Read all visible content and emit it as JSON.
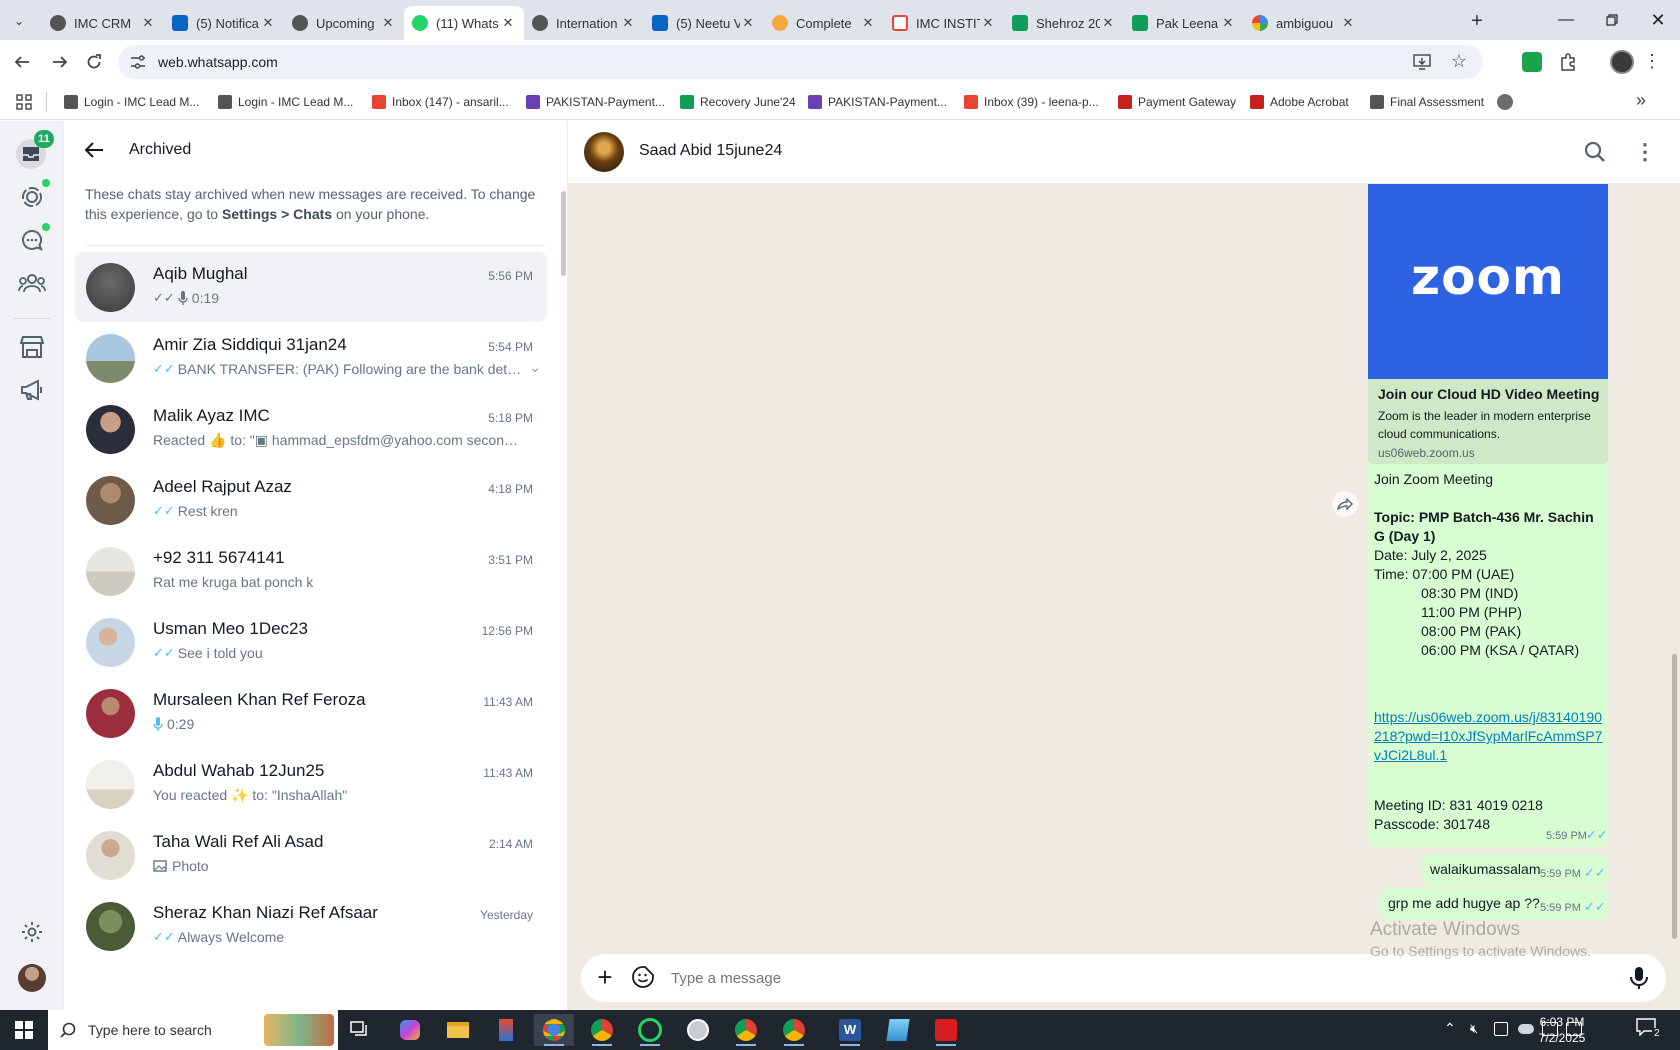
{
  "browser": {
    "tabs": [
      {
        "title": "IMC CRM",
        "icon": "imc-icon"
      },
      {
        "title": "(5) Notifica",
        "icon": "linkedin-icon"
      },
      {
        "title": "Upcoming",
        "icon": "imc-icon"
      },
      {
        "title": "(11) Whats",
        "icon": "whatsapp-icon",
        "active": true
      },
      {
        "title": "Internation",
        "icon": "imc-icon"
      },
      {
        "title": "(5) Neetu V",
        "icon": "linkedin-icon"
      },
      {
        "title": "Complete",
        "icon": "smile-icon"
      },
      {
        "title": "IMC INSTIT",
        "icon": "gmail-icon"
      },
      {
        "title": "Shehroz 20",
        "icon": "sheets-icon"
      },
      {
        "title": "Pak Leena",
        "icon": "sheets-icon"
      },
      {
        "title": "ambiguou",
        "icon": "google-icon"
      }
    ],
    "url": "web.whatsapp.com",
    "bookmarks": [
      {
        "label": "Login - IMC Lead M..."
      },
      {
        "label": "Login - IMC Lead M..."
      },
      {
        "label": "Inbox (147) - ansaril..."
      },
      {
        "label": "PAKISTAN-Payment..."
      },
      {
        "label": "Recovery June'24"
      },
      {
        "label": "PAKISTAN-Payment..."
      },
      {
        "label": "Inbox (39) - leena-p..."
      },
      {
        "label": "Payment Gateway"
      },
      {
        "label": "Adobe Acrobat"
      },
      {
        "label": "Final Assessment"
      }
    ]
  },
  "rail": {
    "unread_badge": "11"
  },
  "archived": {
    "title": "Archived",
    "note_prefix": "These chats stay archived when new messages are received. To change this experience, go to ",
    "note_settings": "Settings > Chats",
    "note_suffix": " on your phone.",
    "chats": [
      {
        "name": "Aqib Mughal",
        "time": "5:56 PM",
        "preview": "0:19",
        "ticks": true,
        "mic": true
      },
      {
        "name": "Amir Zia Siddiqui 31jan24",
        "time": "5:54 PM",
        "preview": "BANK TRANSFER: (PAK) Following are the bank detail...",
        "ticks": true
      },
      {
        "name": "Malik Ayaz IMC",
        "time": "5:18 PM",
        "preview": "Reacted 👍 to: \"▣ hammad_epsfdm@yahoo.com second ..."
      },
      {
        "name": "Adeel Rajput Azaz",
        "time": "4:18 PM",
        "preview": "Rest kren",
        "ticks": true
      },
      {
        "name": "+92 311 5674141",
        "time": "3:51 PM",
        "preview": "Rat me kruga bat ponch k"
      },
      {
        "name": "Usman Meo 1Dec23",
        "time": "12:56 PM",
        "preview": "See i told you",
        "ticks": true
      },
      {
        "name": "Mursaleen Khan Ref Feroza",
        "time": "11:43 AM",
        "preview": "0:29",
        "mic": true
      },
      {
        "name": "Abdul Wahab 12Jun25",
        "time": "11:43 AM",
        "preview": "You reacted ✨ to: \"InshaAllah\""
      },
      {
        "name": "Taha Wali Ref Ali Asad",
        "time": "2:14 AM",
        "preview": "Photo",
        "photo": true
      },
      {
        "name": "Sheraz Khan Niazi Ref Afsaar",
        "time": "Yesterday",
        "preview": "Always Welcome",
        "ticks": true
      }
    ]
  },
  "conversation": {
    "contact": "Saad Abid 15june24",
    "zoom_logo": "zoom",
    "link_title": "Join our Cloud HD Video Meeting",
    "link_desc": "Zoom is the leader in modern enterprise cloud communications.",
    "link_domain": "us06web.zoom.us",
    "msg_lines": [
      "Join Zoom Meeting",
      "",
      "Topic: PMP  Batch-436  Mr. Sachin G  (Day 1)",
      "Date:    July 2, 2025",
      "Time:    07:00 PM (UAE)",
      "08:30 PM (IND)",
      "11:00 PM (PHP)",
      "08:00 PM (PAK)",
      "06:00 PM (KSA / QATAR)"
    ],
    "link_url": "https://us06web.zoom.us/j/83140190218?pwd=I10xJfSypMarlFcAmmSP7vJCi2L8ul.1",
    "meeting_id": "Meeting ID: 831 4019 0218",
    "passcode": "Passcode:  301748",
    "time1": "5:59 PM",
    "msg2": "walaikumassalam",
    "time2": "5:59 PM",
    "msg3": "grp me add hugye ap ??",
    "time3": "5:59 PM",
    "composer_placeholder": "Type a message"
  },
  "watermark": {
    "line1": "Activate Windows",
    "line2": "Go to Settings to activate Windows."
  },
  "taskbar": {
    "search_placeholder": "Type here to search",
    "time": "6:03 PM",
    "date": "7/2/2025",
    "notif_count": "2"
  },
  "colors": {
    "wa_green": "#25d366",
    "bubble": "#d9fdd3",
    "zoom_blue": "#2d63e2",
    "tick_blue": "#53bdeb"
  }
}
